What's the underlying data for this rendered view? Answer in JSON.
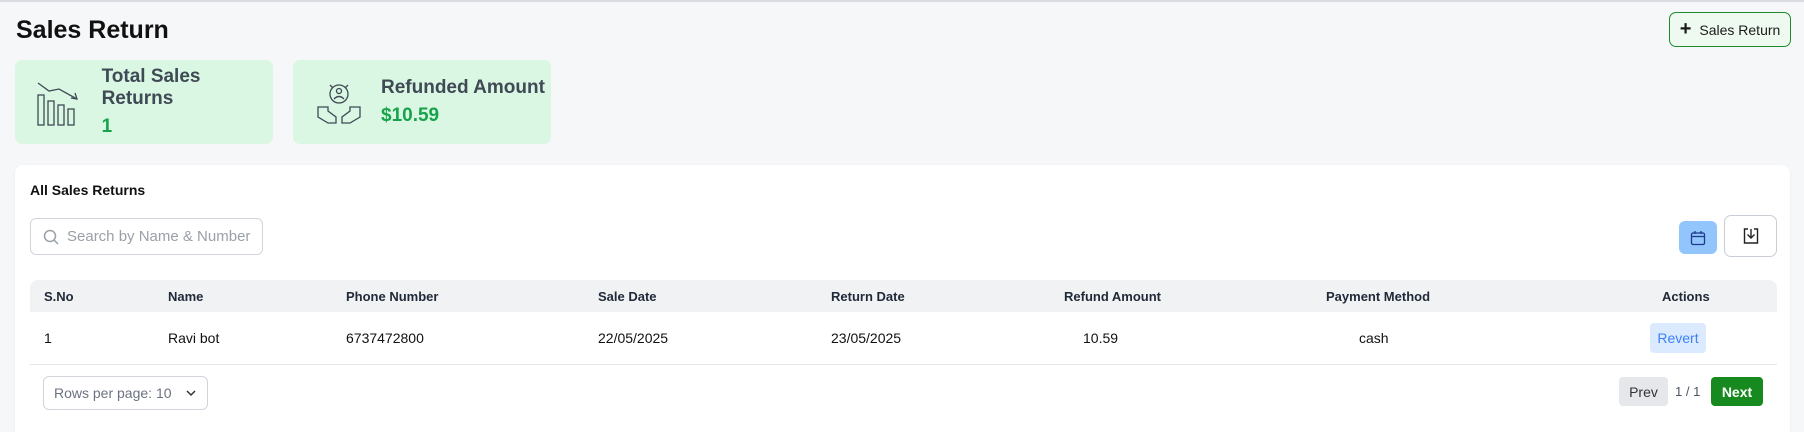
{
  "page": {
    "title": "Sales Return"
  },
  "header": {
    "add_button_label": "Sales Return"
  },
  "stats": [
    {
      "label": "Total Sales Returns",
      "value": "1",
      "icon": "bar-chart-down-icon"
    },
    {
      "label": "Refunded Amount",
      "value": "$10.59",
      "icon": "hands-refund-icon"
    }
  ],
  "panel": {
    "title": "All Sales Returns",
    "search_placeholder": "Search by Name & Number",
    "calendar_icon": "calendar-icon",
    "download_icon": "download-icon"
  },
  "table": {
    "columns": [
      "S.No",
      "Name",
      "Phone Number",
      "Sale Date",
      "Return Date",
      "Refund Amount",
      "Payment Method",
      "Actions"
    ],
    "rows": [
      {
        "sno": "1",
        "name": "Ravi bot",
        "phone": "6737472800",
        "sale_date": "22/05/2025",
        "return_date": "23/05/2025",
        "refund": "10.59",
        "payment": "cash",
        "action": "Revert"
      }
    ]
  },
  "pagination": {
    "rows_per_page": "Rows per page: 10",
    "prev_label": "Prev",
    "page_indicator": "1 / 1",
    "next_label": "Next"
  },
  "colors": {
    "accent_green": "#178a1f",
    "card_bg": "#d9f7e3",
    "stat_value": "#17a34a",
    "calendar_bg": "#93c5fd",
    "revert_bg": "#dbeafe"
  }
}
